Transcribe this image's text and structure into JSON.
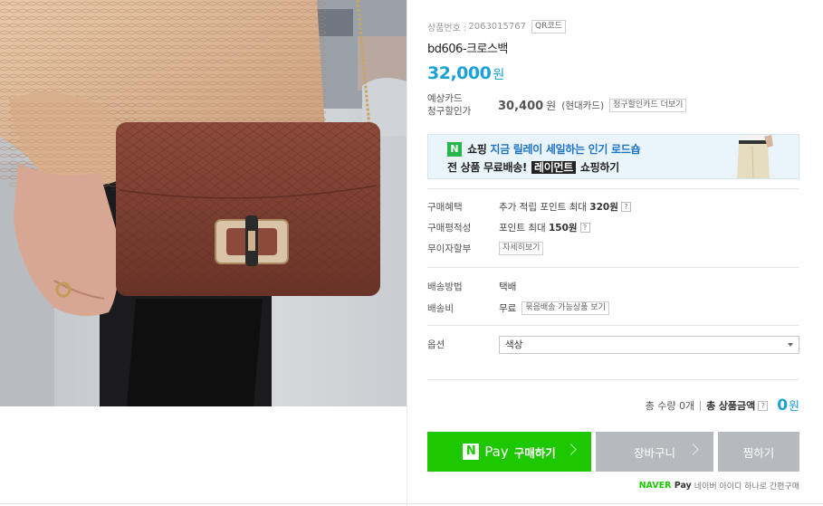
{
  "colors": {
    "accent": "#1aa1d8",
    "naver_green": "#1ec800",
    "gray_button": "#b6b9bd"
  },
  "product": {
    "number_label": "상품번호 :",
    "number": "2063015767",
    "qr_label": "QR코드",
    "title": "bd606-크로스백",
    "price": "32,000",
    "price_unit": "원"
  },
  "card_discount": {
    "label_line1": "예상카드",
    "label_line2": "청구할인가",
    "price": "30,400",
    "price_unit": "원",
    "card_name": "(현대카드)",
    "more_button": "청구할인카드 더보기"
  },
  "banner": {
    "logo": "N",
    "prefix": "쇼핑",
    "highlight": "지금 릴레이 세일하는 인기 로드숍",
    "line2_a": "전 상품 무료배송!",
    "brand": "레이먼트",
    "line2_b": "쇼핑하기"
  },
  "benefits": [
    {
      "key": "구매혜택",
      "text": "추가 적립 포인트 최대",
      "bold": "320원",
      "help": "?"
    },
    {
      "key": "구매평적성",
      "text": "포인트 최대",
      "bold": "150원",
      "help": "?"
    }
  ],
  "installment": {
    "key": "무이자할부",
    "button": "자세히보기"
  },
  "shipping": {
    "method_key": "배송방법",
    "method_value": "택배",
    "fee_key": "배송비",
    "fee_value": "무료",
    "bundle_button": "묶음배송 가능상품 보기"
  },
  "option": {
    "key": "옵션",
    "selected": "색상"
  },
  "total": {
    "qty_label": "총 수량",
    "qty": "0개",
    "total_prefix": "총",
    "total_label": "상품금액",
    "help": "?",
    "amount": "0",
    "unit": "원"
  },
  "buttons": {
    "npay_logo": "N",
    "npay_pay": "Pay",
    "npay_label": "구매하기",
    "cart": "장바구니",
    "wish": "찜하기"
  },
  "npay_footer": {
    "logo_naver": "NAVER",
    "logo_pay": "Pay",
    "text": "네이버 아이디 하나로 간편구매"
  }
}
